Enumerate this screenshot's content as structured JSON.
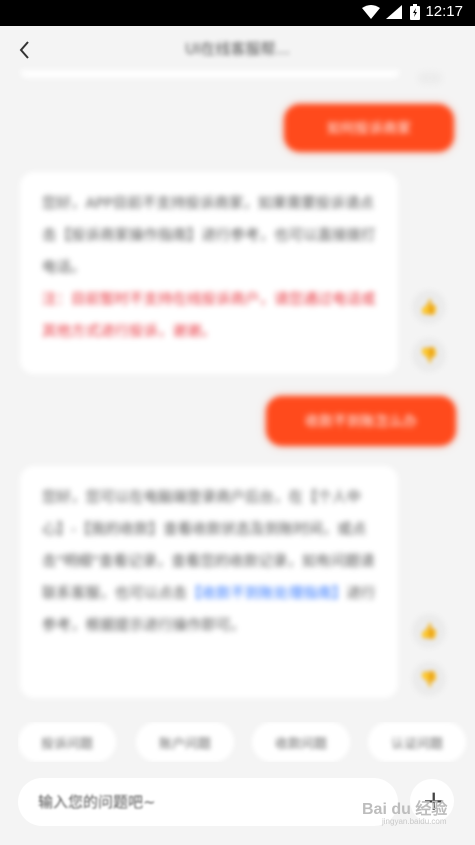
{
  "status": {
    "time": "12:17"
  },
  "header": {
    "title": "UI在线客服帮..."
  },
  "messages": [
    {
      "role": "user",
      "text": "如何投诉商家"
    },
    {
      "role": "bot",
      "lines": [
        {
          "text": "您好，APP目前不支持投诉商家，如果需要投诉请点击【投诉商家操作指"
        },
        {
          "text": "南】进行参考，也可以直接拨打电话。"
        },
        {
          "text": "注：目前暂时不支持在线投诉商户，请您通过电话或其他方式进行投诉，谢谢。",
          "emphasis": true
        }
      ]
    },
    {
      "role": "user",
      "text": "收款不到账怎么办"
    },
    {
      "role": "bot",
      "lines": [
        {
          "text": "您好，您可以在电脑端登录商户后台，在【个人中心】-【我的收款】查看收款状态及到账时间，或点击\"明细\"查看记录，查看您的收款记录，如有问题请联系客服，也可以点击"
        },
        {
          "text": "【收款不到账处理指南】",
          "link": true
        },
        {
          "text": "进行参考，根据提示进行操作即可。"
        }
      ]
    }
  ],
  "quick_replies": [
    "投诉问题",
    "账户问题",
    "收款问题",
    "认证问题"
  ],
  "input": {
    "placeholder": "输入您的问题吧~"
  },
  "watermark": {
    "text": "Bai du 经验",
    "sub": "jingyan.baidu.com"
  }
}
